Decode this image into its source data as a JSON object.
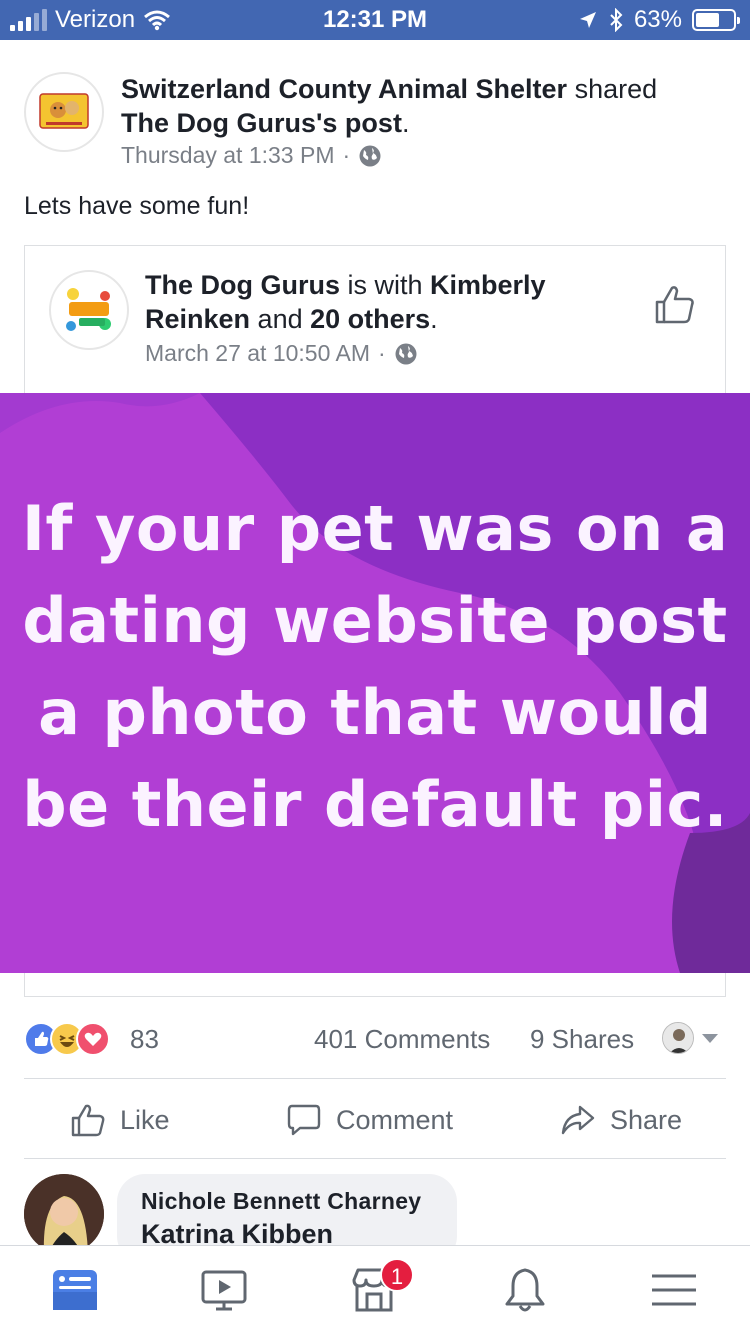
{
  "status_bar": {
    "carrier": "Verizon",
    "time": "12:31 PM",
    "battery": "63%",
    "battery_level": 0.63
  },
  "post": {
    "author": "Switzerland County Animal Shelter",
    "action": " shared ",
    "shared_from": "The Dog Gurus's post",
    "period": ".",
    "timestamp": "Thursday at 1:33 PM",
    "separator": "·",
    "text": "Lets have some fun!"
  },
  "shared_post": {
    "author": "The Dog Gurus",
    "with_text": " is with ",
    "tagged": "Kimberly Reinken",
    "and_text": " and ",
    "others": "20 others",
    "period": ".",
    "timestamp": "March 27 at 10:50 AM",
    "separator": "·",
    "image_text": [
      "If your pet was on a",
      "dating website post",
      "a photo that would",
      "be their default pic."
    ]
  },
  "reactions": {
    "count": "83",
    "comments": "401 Comments",
    "shares": "9 Shares"
  },
  "actions": {
    "like": "Like",
    "comment": "Comment",
    "share": "Share"
  },
  "comment_preview": {
    "name": "Nichole Bennett Charney",
    "text": "Katrina Kibben"
  },
  "tab_bar": {
    "marketplace_badge": "1"
  },
  "colors": {
    "facebook_blue": "#4267b2",
    "promo_purple": "#b23fd6",
    "badge_red": "#e41e3f"
  }
}
